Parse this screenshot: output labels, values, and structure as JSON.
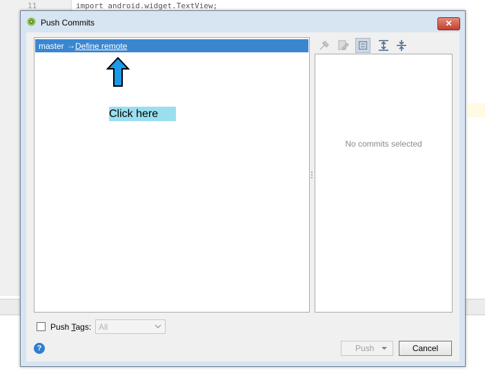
{
  "editor": {
    "line_number": "11",
    "code_line": "import android.widget.TextView;"
  },
  "dialog": {
    "title": "Push Commits",
    "close_glyph": "✕",
    "branch": {
      "name": "master",
      "arrow": "→",
      "remote_link": "Define remote"
    },
    "annotation": {
      "label": "Click here",
      "arrow_color": "#1a9ae8",
      "label_background": "#99dff0"
    },
    "toolbar_icons": [
      "pin-icon",
      "edit-source-icon",
      "group-by-icon",
      "expand-all-icon",
      "collapse-all-icon"
    ],
    "details": {
      "empty_text": "No commits selected"
    },
    "push_tags": {
      "label": "Push Tags:",
      "checked": false,
      "select_value": "All"
    },
    "help_glyph": "?",
    "buttons": {
      "push": "Push",
      "cancel": "Cancel"
    }
  },
  "colors": {
    "selection": "#3a87d0",
    "dialog_frame": "#d7e4f2",
    "close_button": "#c4402c"
  }
}
